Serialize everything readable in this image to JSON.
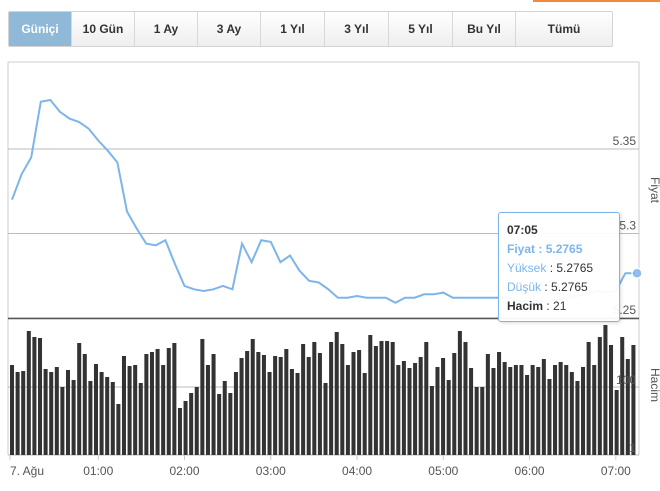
{
  "tabs": [
    {
      "label": "Güniçi",
      "active": true
    },
    {
      "label": "10 Gün",
      "active": false
    },
    {
      "label": "1 Ay",
      "active": false
    },
    {
      "label": "3 Ay",
      "active": false
    },
    {
      "label": "1 Yıl",
      "active": false
    },
    {
      "label": "3 Yıl",
      "active": false
    },
    {
      "label": "5 Yıl",
      "active": false
    },
    {
      "label": "Bu Yıl",
      "active": false
    },
    {
      "label": "Tümü",
      "active": false
    }
  ],
  "colors": {
    "price_line": "#7cb5ec",
    "volume_bar": "#333333",
    "accent": "#f08a3c"
  },
  "chart_data": {
    "type": "line",
    "price": {
      "axis_label": "Fiyat",
      "ticks": [
        "5.35",
        "5.3",
        "5.25"
      ],
      "tick_values": [
        5.35,
        5.3,
        5.25
      ],
      "times_min": [
        0,
        10,
        20,
        30,
        40,
        50,
        60,
        70,
        80,
        90,
        100,
        110,
        120,
        130,
        140,
        150,
        160,
        170,
        180,
        190,
        200,
        210,
        220,
        230,
        240,
        250,
        260,
        270,
        280,
        290,
        300,
        310,
        320,
        330,
        340,
        350,
        360,
        370,
        380,
        390,
        400,
        410,
        420,
        430,
        440,
        450,
        460,
        470,
        480,
        490,
        500,
        510,
        520,
        530,
        540,
        550,
        560,
        570,
        580,
        590,
        600,
        610,
        620,
        630,
        640,
        650
      ],
      "values": [
        5.32,
        5.335,
        5.345,
        5.378,
        5.379,
        5.372,
        5.368,
        5.366,
        5.362,
        5.355,
        5.349,
        5.342,
        5.313,
        5.303,
        5.294,
        5.293,
        5.296,
        5.282,
        5.269,
        5.267,
        5.266,
        5.267,
        5.269,
        5.267,
        5.294,
        5.283,
        5.296,
        5.295,
        5.283,
        5.287,
        5.278,
        5.272,
        5.271,
        5.267,
        5.262,
        5.262,
        5.263,
        5.262,
        5.262,
        5.262,
        5.259,
        5.262,
        5.262,
        5.264,
        5.264,
        5.265,
        5.262,
        5.262,
        5.262,
        5.262,
        5.262,
        5.262,
        5.262,
        5.26,
        5.26,
        5.26,
        5.26,
        5.261,
        5.262,
        5.263,
        5.264,
        5.266,
        5.265,
        5.266,
        5.2765,
        5.2765
      ]
    },
    "volume": {
      "axis_label": "Hacim",
      "ticks": [
        "100",
        "1"
      ],
      "values": [
        90,
        83,
        84,
        124,
        118,
        117,
        86,
        83,
        88,
        68,
        85,
        75,
        112,
        101,
        74,
        91,
        83,
        78,
        73,
        51,
        99,
        89,
        90,
        72,
        101,
        103,
        106,
        90,
        107,
        112,
        47,
        54,
        62,
        68,
        116,
        90,
        101,
        61,
        74,
        62,
        83,
        97,
        104,
        116,
        103,
        100,
        83,
        99,
        98,
        106,
        86,
        82,
        111,
        98,
        113,
        102,
        72,
        113,
        123,
        111,
        90,
        103,
        105,
        82,
        120,
        109,
        114,
        114,
        113,
        90,
        94,
        87,
        92,
        98,
        113,
        69,
        88,
        97,
        75,
        102,
        124,
        113,
        87,
        68,
        68,
        101,
        87,
        103,
        93,
        88,
        90,
        90,
        80,
        90,
        88,
        96,
        76,
        90,
        93,
        90,
        83,
        74,
        88,
        113,
        90,
        118,
        130,
        110,
        65,
        118,
        96,
        110
      ]
    },
    "x_ticks": [
      "7. Ağu",
      "01:00",
      "02:00",
      "03:00",
      "04:00",
      "05:00",
      "06:00",
      "07:00"
    ],
    "x_tick_minutes": [
      0,
      90,
      180,
      270,
      360,
      450,
      540,
      630
    ]
  },
  "tooltip": {
    "time": "07:05",
    "fiyat_label": "Fiyat",
    "fiyat_value": "5.2765",
    "yuksek_label": "Yüksek",
    "yuksek_value": "5.2765",
    "dusuk_label": "Düşük",
    "dusuk_value": "5.2765",
    "hacim_label": "Hacim",
    "hacim_value": "21"
  }
}
